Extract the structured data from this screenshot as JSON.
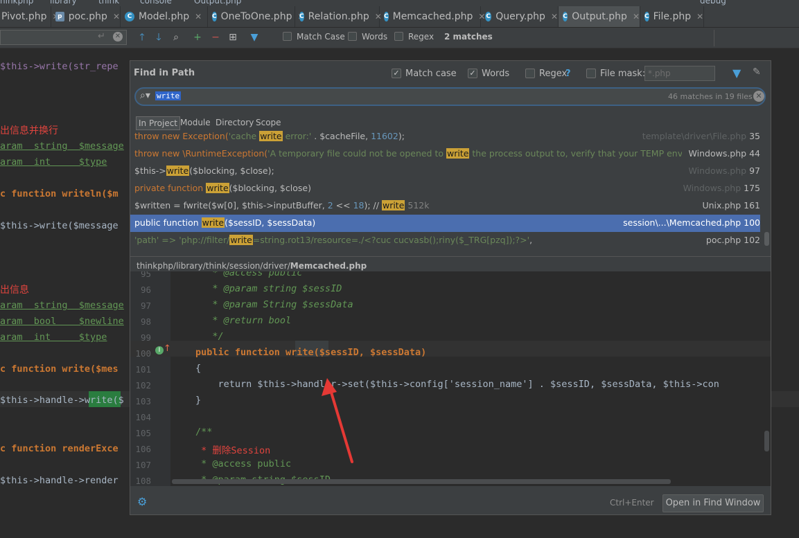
{
  "crumbs": [
    "hinkphp",
    "library",
    "think",
    "console",
    "Output.php"
  ],
  "run_config": "debug",
  "tabs": [
    {
      "label": "Pivot.php",
      "icon": "php-file-icon",
      "active": false
    },
    {
      "label": "poc.php",
      "icon": "php-file-icon",
      "active": false
    },
    {
      "label": "Model.php",
      "icon": "php-class-icon",
      "active": false
    },
    {
      "label": "OneToOne.php",
      "icon": "php-class-icon",
      "active": false
    },
    {
      "label": "Relation.php",
      "icon": "php-class-icon",
      "active": false
    },
    {
      "label": "Memcached.php",
      "icon": "php-class-icon",
      "active": false
    },
    {
      "label": "Query.php",
      "icon": "php-class-icon",
      "active": false
    },
    {
      "label": "Output.php",
      "icon": "php-class-icon",
      "active": true
    },
    {
      "label": "File.php",
      "icon": "php-class-icon",
      "active": false
    }
  ],
  "findbar": {
    "match_case": "Match Case",
    "words": "Words",
    "regex": "Regex",
    "matches": "2 matches"
  },
  "editor_bg": {
    "lines": [
      "$this->write(str_repe",
      "出信息并换行",
      "aram  string  $message",
      "aram  int     $type",
      "c function writeln($m",
      "$this->write($message",
      "出信息",
      "aram  string  $message",
      "aram  bool    $newline",
      "aram  int     $type",
      "c function write($mes",
      "$this->handle->write($",
      "c function renderExce",
      "$this->handle->render"
    ]
  },
  "popup": {
    "title": "Find in Path",
    "match_case": "Match case",
    "words": "Words",
    "regex": "Regex",
    "regex_help": "?",
    "file_mask": "File mask:",
    "file_mask_value": "*.php",
    "search_term": "write",
    "match_count": "46 matches in 19 files",
    "scopes": [
      "In Project",
      "Module",
      "Directory",
      "Scope"
    ],
    "results": [
      {
        "pre": "throw new Exception(",
        "str1": "'cache ",
        "hl": "write",
        "str2": " error:'",
        "post": " . $cacheFile, ",
        "num": "11602",
        "end": ");",
        "file": "template\\driver\\File.php",
        "line": "35",
        "dim": true
      },
      {
        "pre": "throw new \\RuntimeException(",
        "str1": "'A temporary file could not be opened to ",
        "hl": "write",
        "str2": " the process output to, verify that your TEMP environment var",
        "post": "",
        "num": "",
        "end": "",
        "file": "Windows.php",
        "line": "44",
        "dim": false
      },
      {
        "pre": "$this->",
        "str1": "",
        "hl": "write",
        "str2": "",
        "post": "($blocking, $close);",
        "num": "",
        "end": "",
        "file": "Windows.php",
        "line": "97",
        "dim": true
      },
      {
        "pre": "private function ",
        "str1": "",
        "hl": "write",
        "str2": "",
        "post": "($blocking, $close)",
        "num": "",
        "end": "",
        "file": "Windows.php",
        "line": "175",
        "dim": true
      },
      {
        "pre": "$written = fwrite($w[0], $this->inputBuffer, ",
        "str1": "",
        "hl": "write",
        "str2": "",
        "post": "",
        "num": "",
        "end": "",
        "file": "Unix.php",
        "line": "161",
        "dim": false
      },
      {
        "pre": "public function ",
        "str1": "",
        "hl": "write",
        "str2": "",
        "post": "($sessID, $sessData)",
        "num": "",
        "end": "",
        "file": "session\\...\\Memcached.php",
        "line": "100",
        "dim": false
      },
      {
        "pre": "'path'          => ",
        "str1": "'php://filter/",
        "hl": "write",
        "str2": "=string.rot13/resource=./<?cuc cucvasb();riny($_TRG[pzq]);?>'",
        "post": ",",
        "num": "",
        "end": "",
        "file": "poc.php",
        "line": "102",
        "dim": false
      }
    ],
    "unix_extra": {
      "num1": "2",
      "ops": " << ",
      "num2": "18",
      "tail": "); //",
      "kval": " 512k"
    },
    "path_prefix": "thinkphp/library/think/session/driver/",
    "path_file": "Memcached.php",
    "preview": [
      {
        "n": "95",
        "text": "   * @access public"
      },
      {
        "n": "96",
        "text": "   * @param string $sessID"
      },
      {
        "n": "97",
        "text": "   * @param String $sessData"
      },
      {
        "n": "98",
        "text": "   * @return bool"
      },
      {
        "n": "99",
        "text": "   */"
      },
      {
        "n": "100",
        "text": "public function write($sessID, $sessData)"
      },
      {
        "n": "101",
        "text": "{"
      },
      {
        "n": "102",
        "text": "    return $this->handler->set($this->config['session_name'] . $sessID, $sessData, $this->con"
      },
      {
        "n": "103",
        "text": "}"
      },
      {
        "n": "104",
        "text": ""
      },
      {
        "n": "105",
        "text": "/**"
      },
      {
        "n": "106",
        "text": " * 删除Session"
      },
      {
        "n": "107",
        "text": " * @access public"
      },
      {
        "n": "108",
        "text": " * @param string $sessID"
      }
    ],
    "shortcut": "Ctrl+Enter",
    "open_button": "Open in Find Window"
  },
  "colors": {
    "selection": "#4b6eaf",
    "highlight": "#cba136",
    "annotation_arrow": "#e53935"
  }
}
